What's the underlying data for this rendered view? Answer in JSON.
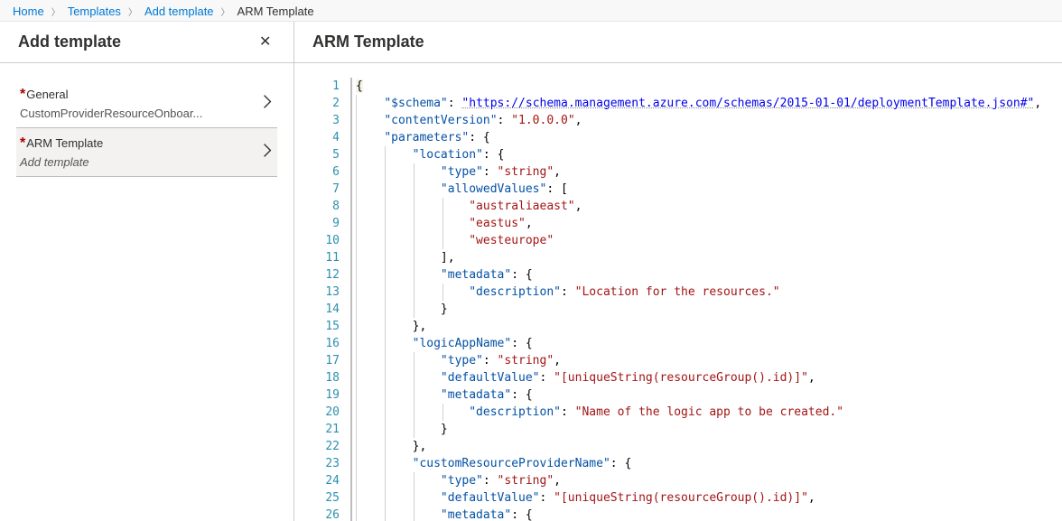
{
  "breadcrumb": {
    "home": "Home",
    "templates": "Templates",
    "add_template": "Add template",
    "current": "ARM Template"
  },
  "left": {
    "title": "Add template",
    "close_aria": "Close",
    "steps": [
      {
        "label": "General",
        "sub": "CustomProviderResourceOnboar...",
        "sub_italic": false,
        "active": false
      },
      {
        "label": "ARM Template",
        "sub": "Add template",
        "sub_italic": true,
        "active": true
      }
    ]
  },
  "right": {
    "title": "ARM Template"
  },
  "editor": {
    "total_lines_visible": 26,
    "tokens": [
      [
        {
          "t": "br",
          "v": "{",
          "cls": "openbrace-hl"
        }
      ],
      [
        {
          "t": "pk",
          "v": "\"$schema\""
        },
        {
          "t": "pn",
          "v": ": "
        },
        {
          "t": "ln",
          "v": "\"https://schema.management.azure.com/schemas/2015-01-01/deploymentTemplate.json#\""
        },
        {
          "t": "pn",
          "v": ","
        }
      ],
      [
        {
          "t": "pk",
          "v": "\"contentVersion\""
        },
        {
          "t": "pn",
          "v": ": "
        },
        {
          "t": "st",
          "v": "\"1.0.0.0\""
        },
        {
          "t": "pn",
          "v": ","
        }
      ],
      [
        {
          "t": "pk",
          "v": "\"parameters\""
        },
        {
          "t": "pn",
          "v": ": "
        },
        {
          "t": "br",
          "v": "{"
        }
      ],
      [
        {
          "t": "pk",
          "v": "\"location\""
        },
        {
          "t": "pn",
          "v": ": "
        },
        {
          "t": "br",
          "v": "{"
        }
      ],
      [
        {
          "t": "pk",
          "v": "\"type\""
        },
        {
          "t": "pn",
          "v": ": "
        },
        {
          "t": "st",
          "v": "\"string\""
        },
        {
          "t": "pn",
          "v": ","
        }
      ],
      [
        {
          "t": "pk",
          "v": "\"allowedValues\""
        },
        {
          "t": "pn",
          "v": ": ["
        }
      ],
      [
        {
          "t": "st",
          "v": "\"australiaeast\""
        },
        {
          "t": "pn",
          "v": ","
        }
      ],
      [
        {
          "t": "st",
          "v": "\"eastus\""
        },
        {
          "t": "pn",
          "v": ","
        }
      ],
      [
        {
          "t": "st",
          "v": "\"westeurope\""
        }
      ],
      [
        {
          "t": "pn",
          "v": "],"
        }
      ],
      [
        {
          "t": "pk",
          "v": "\"metadata\""
        },
        {
          "t": "pn",
          "v": ": "
        },
        {
          "t": "br",
          "v": "{"
        }
      ],
      [
        {
          "t": "pk",
          "v": "\"description\""
        },
        {
          "t": "pn",
          "v": ": "
        },
        {
          "t": "st",
          "v": "\"Location for the resources.\""
        }
      ],
      [
        {
          "t": "br",
          "v": "}"
        }
      ],
      [
        {
          "t": "br",
          "v": "},"
        }
      ],
      [
        {
          "t": "pk",
          "v": "\"logicAppName\""
        },
        {
          "t": "pn",
          "v": ": "
        },
        {
          "t": "br",
          "v": "{"
        }
      ],
      [
        {
          "t": "pk",
          "v": "\"type\""
        },
        {
          "t": "pn",
          "v": ": "
        },
        {
          "t": "st",
          "v": "\"string\""
        },
        {
          "t": "pn",
          "v": ","
        }
      ],
      [
        {
          "t": "pk",
          "v": "\"defaultValue\""
        },
        {
          "t": "pn",
          "v": ": "
        },
        {
          "t": "st",
          "v": "\"[uniqueString(resourceGroup().id)]\""
        },
        {
          "t": "pn",
          "v": ","
        }
      ],
      [
        {
          "t": "pk",
          "v": "\"metadata\""
        },
        {
          "t": "pn",
          "v": ": "
        },
        {
          "t": "br",
          "v": "{"
        }
      ],
      [
        {
          "t": "pk",
          "v": "\"description\""
        },
        {
          "t": "pn",
          "v": ": "
        },
        {
          "t": "st",
          "v": "\"Name of the logic app to be created.\""
        }
      ],
      [
        {
          "t": "br",
          "v": "}"
        }
      ],
      [
        {
          "t": "br",
          "v": "},"
        }
      ],
      [
        {
          "t": "pk",
          "v": "\"customResourceProviderName\""
        },
        {
          "t": "pn",
          "v": ": "
        },
        {
          "t": "br",
          "v": "{"
        }
      ],
      [
        {
          "t": "pk",
          "v": "\"type\""
        },
        {
          "t": "pn",
          "v": ": "
        },
        {
          "t": "st",
          "v": "\"string\""
        },
        {
          "t": "pn",
          "v": ","
        }
      ],
      [
        {
          "t": "pk",
          "v": "\"defaultValue\""
        },
        {
          "t": "pn",
          "v": ": "
        },
        {
          "t": "st",
          "v": "\"[uniqueString(resourceGroup().id)]\""
        },
        {
          "t": "pn",
          "v": ","
        }
      ],
      [
        {
          "t": "pk",
          "v": "\"metadata\""
        },
        {
          "t": "pn",
          "v": ": "
        },
        {
          "t": "br",
          "v": "{"
        }
      ]
    ],
    "indents": [
      0,
      1,
      1,
      1,
      2,
      3,
      3,
      4,
      4,
      4,
      3,
      3,
      4,
      3,
      2,
      2,
      3,
      3,
      3,
      4,
      3,
      2,
      2,
      3,
      3,
      3
    ]
  }
}
